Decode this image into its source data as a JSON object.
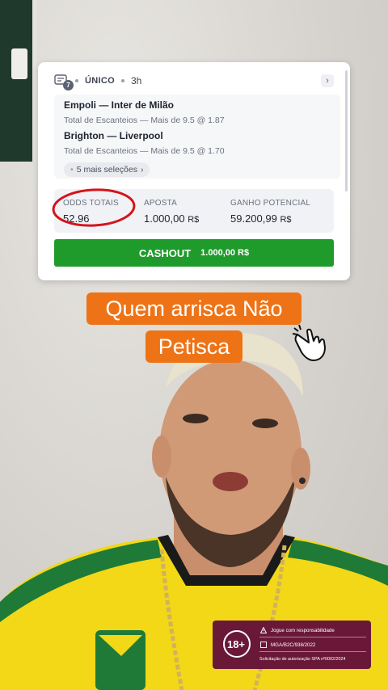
{
  "bet_card": {
    "ticket_count": "7",
    "type": "ÚNICO",
    "time": "3h",
    "selections": [
      {
        "match": "Empoli — Inter de Milão",
        "market": "Total de Escanteios — Mais de 9.5 @ 1.87"
      },
      {
        "match": "Brighton — Liverpool",
        "market": "Total de Escanteios — Mais de 9.5 @ 1.70"
      }
    ],
    "more_selections": "5 mais seleções",
    "odds_label": "ODDS TOTAIS",
    "odds_value": "52.96",
    "stake_label": "APOSTA",
    "stake_value": "1.000,00",
    "stake_currency": "R$",
    "potential_label": "GANHO POTENCIAL",
    "potential_value": "59.200,99",
    "potential_currency": "R$",
    "cashout_label": "CASHOUT",
    "cashout_amount": "1.000,00 R$"
  },
  "caption": {
    "line1": "Quem arrisca Não",
    "line2": "Petisca"
  },
  "badge": {
    "age": "18+",
    "line1": "Jogue com responsabilidade",
    "line2": "MGA/B2C/938/2022",
    "line3": "Solicitação de autorização SPA nº0002/2024"
  },
  "colors": {
    "cashout_green": "#1f9b2b",
    "caption_orange": "#ee7316",
    "badge_maroon": "#6a1838",
    "highlight_red": "#d4141c"
  }
}
